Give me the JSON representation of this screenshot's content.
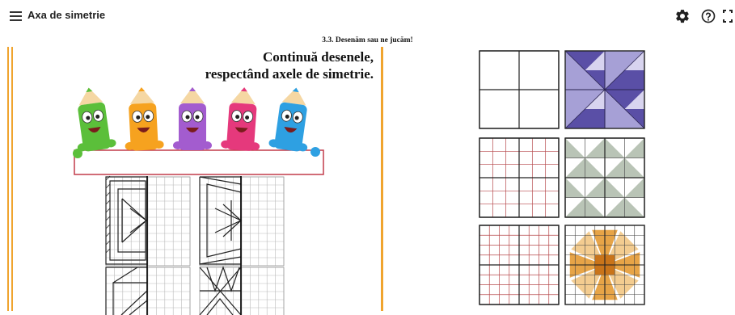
{
  "app": {
    "title": "Axa de simetrie"
  },
  "toolbar": {
    "settings_icon": "gear-icon",
    "help_icon": "help-circle-icon",
    "fullscreen_icon": "fullscreen-icon"
  },
  "page": {
    "header": "3.3. Desenăm sau ne jucăm!",
    "heading_line1": "Continuă desenele,",
    "heading_line2": "respectând axele de simetrie."
  },
  "colors": {
    "accent_bar": "#f0a42e",
    "purple_tile": "#5a4fa6",
    "purple_light": "#a6a0d6",
    "sage_tile": "#b9c4b6",
    "grid_red": "#b6484b",
    "orange_star": "#e49a33",
    "orange_light": "#f2c784"
  },
  "illustration": {
    "pencils": [
      {
        "name": "green",
        "color": "#5bbf3a"
      },
      {
        "name": "orange",
        "color": "#f6a21f"
      },
      {
        "name": "purple",
        "color": "#a35ccf"
      },
      {
        "name": "pink",
        "color": "#e5397c"
      },
      {
        "name": "blue",
        "color": "#2ea0e2"
      }
    ]
  }
}
